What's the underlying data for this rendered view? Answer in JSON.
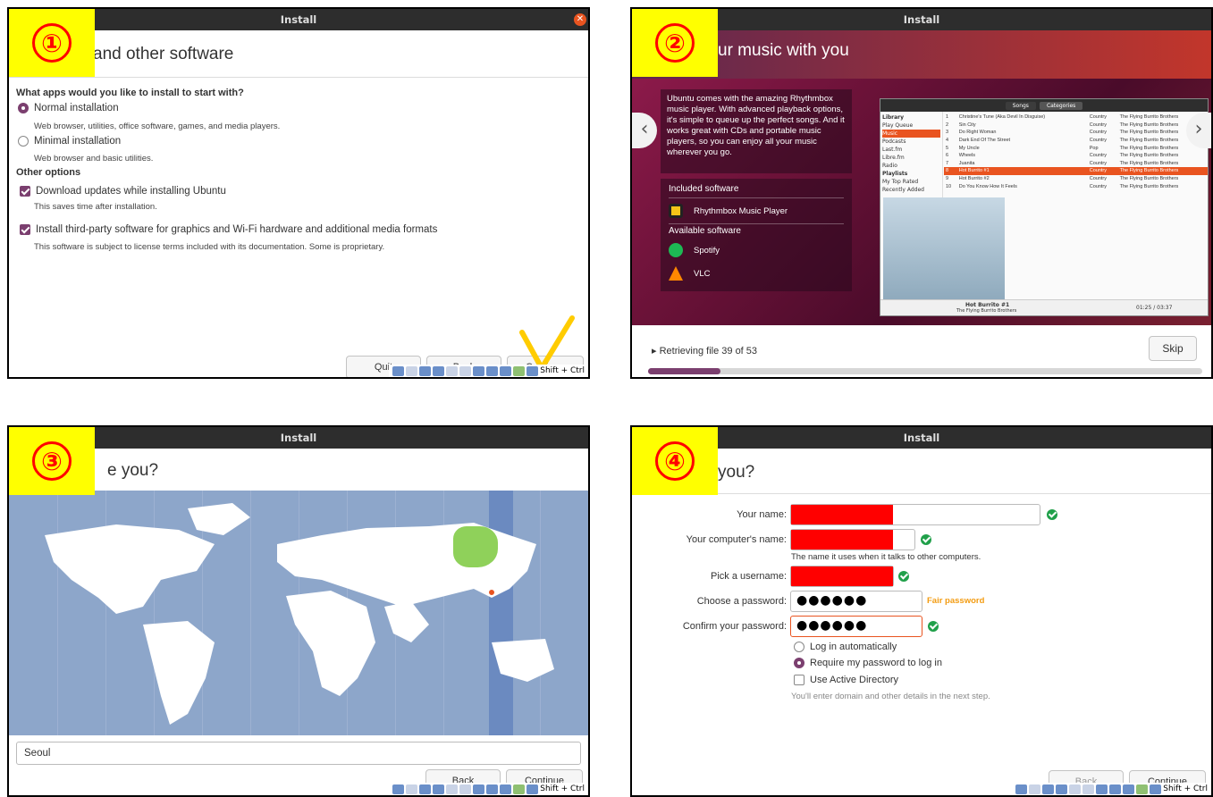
{
  "panel1": {
    "badge": "①",
    "title": "Install",
    "heading": "and other software",
    "question": "What apps would you like to install to start with?",
    "normal_label": "Normal installation",
    "normal_desc": "Web browser, utilities, office software, games, and media players.",
    "minimal_label": "Minimal installation",
    "minimal_desc": "Web browser and basic utilities.",
    "other_options": "Other options",
    "download_label": "Download updates while installing Ubuntu",
    "download_desc": "This saves time after installation.",
    "thirdparty_label": "Install third-party software for graphics and Wi-Fi hardware and additional media formats",
    "thirdparty_desc": "This software is subject to license terms included with its documentation. Some is proprietary.",
    "quit": "Quit",
    "back": "Back",
    "continue": "Continue",
    "shortcut": "Shift + Ctrl"
  },
  "panel2": {
    "badge": "②",
    "title": "Install",
    "heading": "ur music with you",
    "slide_text": "Ubuntu comes with the amazing Rhythmbox music player. With advanced playback options, it's simple to queue up the perfect songs. And it works great with CDs and portable music players, so you can enjoy all your music wherever you go.",
    "included_title": "Included software",
    "included_app": "Rhythmbox Music Player",
    "available_title": "Available software",
    "available_apps": [
      "Spotify",
      "VLC"
    ],
    "rb_tabs": [
      "Songs",
      "Categories"
    ],
    "rb_side": [
      "Library",
      "Play Queue",
      "Music",
      "Podcasts",
      "Last.fm",
      "Libre.fm",
      "Radio",
      "Playlists",
      "My Top Rated",
      "Recently Added"
    ],
    "rb_rows": [
      [
        "1",
        "Christine's Tune (Aka Devil In Disguise)",
        "Country",
        "The Flying Burrito Brothers"
      ],
      [
        "2",
        "Sin City",
        "Country",
        "The Flying Burrito Brothers"
      ],
      [
        "3",
        "Do Right Woman",
        "Country",
        "The Flying Burrito Brothers"
      ],
      [
        "4",
        "Dark End Of The Street",
        "Country",
        "The Flying Burrito Brothers"
      ],
      [
        "5",
        "My Uncle",
        "Pop",
        "The Flying Burrito Brothers"
      ],
      [
        "6",
        "Wheels",
        "Country",
        "The Flying Burrito Brothers"
      ],
      [
        "7",
        "Juanita",
        "Country",
        "The Flying Burrito Brothers"
      ],
      [
        "8",
        "Hot Burrito #1",
        "Country",
        "The Flying Burrito Brothers"
      ],
      [
        "9",
        "Hot Burrito #2",
        "Country",
        "The Flying Burrito Brothers"
      ],
      [
        "10",
        "Do You Know How It Feels",
        "Country",
        "The Flying Burrito Brothers"
      ]
    ],
    "now_playing": "Hot Burrito #1",
    "now_artist": "The Flying Burrito Brothers",
    "time": "01:25 / 03:37",
    "status": "Retrieving file 39 of 53",
    "skip": "Skip",
    "progress": 0.13
  },
  "panel3": {
    "badge": "③",
    "title": "Install",
    "heading": "e you?",
    "location": "Seoul",
    "back": "Back",
    "continue": "Continue",
    "shortcut": "Shift + Ctrl"
  },
  "panel4": {
    "badge": "④",
    "title": "Install",
    "heading": "you?",
    "your_name": "Your name:",
    "computer_name": "Your computer's name:",
    "computer_hint": "The name it uses when it talks to other computers.",
    "username": "Pick a username:",
    "password": "Choose a password:",
    "password_value": "●●●●●●",
    "strength": "Fair password",
    "confirm": "Confirm your password:",
    "confirm_value": "●●●●●●",
    "auto_login": "Log in automatically",
    "require_pw": "Require my password to log in",
    "active_dir": "Use Active Directory",
    "ad_hint": "You'll enter domain and other details in the next step.",
    "back": "Back",
    "continue": "Continue",
    "shortcut": "Shift + Ctrl"
  },
  "colors": {
    "accent": "#7b3f6f",
    "badge_bg": "#ffff00",
    "badge_fg": "#ff0000",
    "ok": "#20a04a",
    "strength": "#f39c12",
    "ubuntu_orange": "#e95420"
  }
}
